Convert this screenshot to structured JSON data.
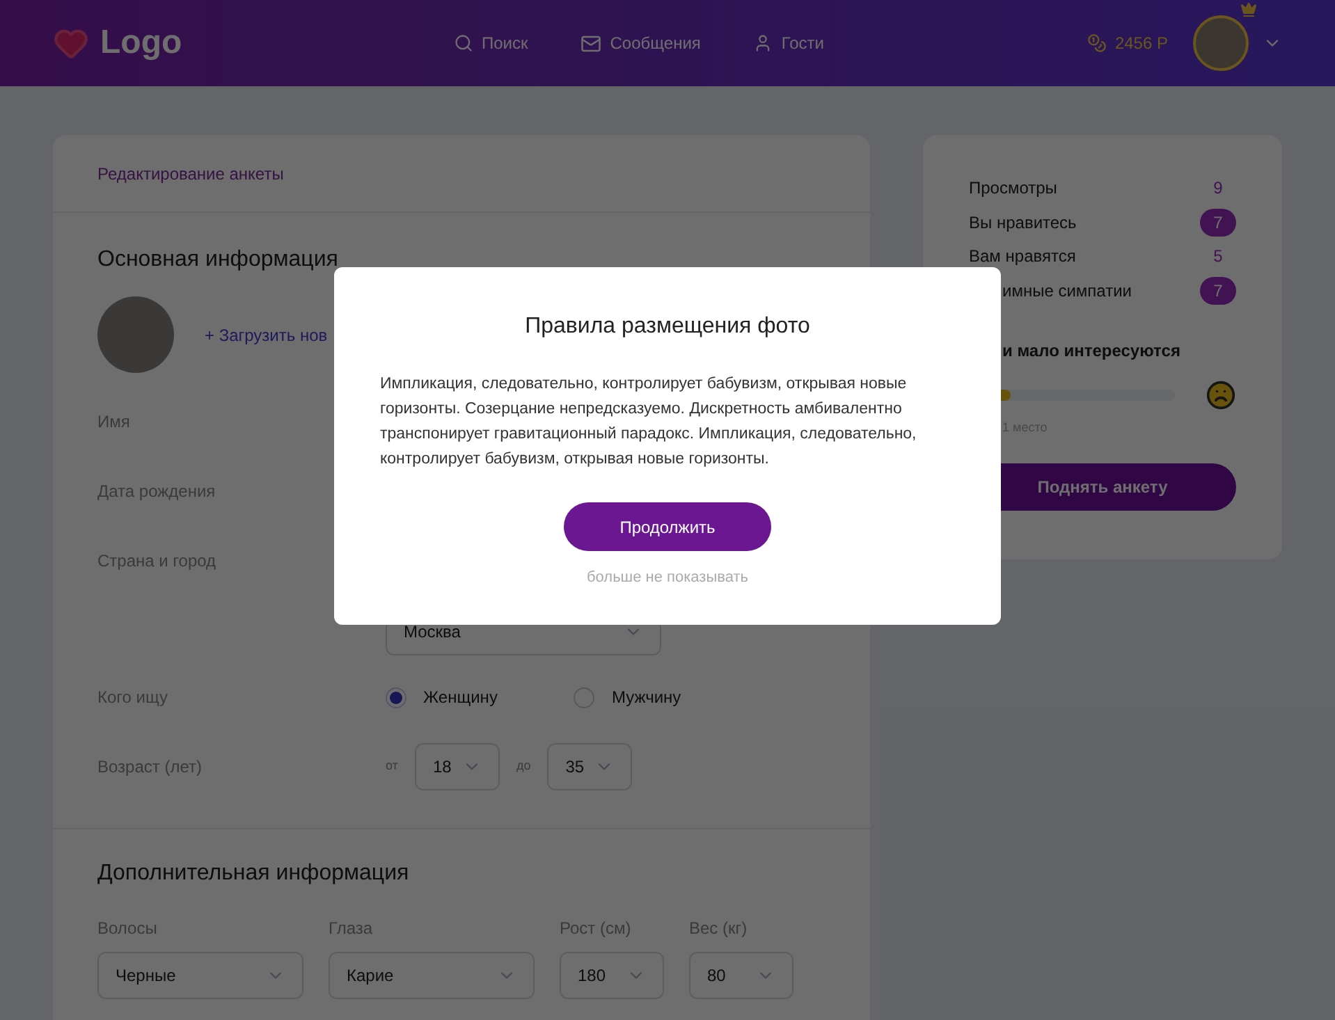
{
  "header": {
    "logo": "Logo",
    "nav": [
      {
        "kind": "search",
        "label": "Поиск"
      },
      {
        "kind": "mail",
        "label": "Сообщения"
      },
      {
        "kind": "user",
        "label": "Гости"
      }
    ],
    "balance": "2456 Р"
  },
  "profile_card": {
    "breadcrumb": "Редактирование анкеты",
    "main_title": "Основная информация",
    "upload_link": "+ Загрузить нов",
    "field_labels": [
      "Имя",
      "Дата рождения",
      "Страна и город"
    ],
    "city": "Москва",
    "looking_for": {
      "label": "Кого ищу",
      "options": [
        {
          "label": "Женщину",
          "selected": true
        },
        {
          "label": "Мужчину",
          "selected": false
        }
      ]
    },
    "age": {
      "label": "Возраст (лет)",
      "from_label": "от",
      "from": "18",
      "to_label": "до",
      "to": "35"
    },
    "extra_title": "Дополнительная информация",
    "extra_fields": [
      {
        "label": "Волосы",
        "value": "Черные"
      },
      {
        "label": "Глаза",
        "value": "Карие"
      },
      {
        "label": "Рост (см)",
        "value": "180"
      },
      {
        "label": "Вес (кг)",
        "value": "80"
      }
    ]
  },
  "stats": {
    "rows": [
      {
        "label": "Просмотры",
        "value": "9",
        "kind": "plain"
      },
      {
        "label": "Вы нравитесь",
        "value": "7",
        "kind": "badge"
      },
      {
        "label": "Вам нравятся",
        "value": "5",
        "kind": "plain"
      },
      {
        "label": "имные симпатии",
        "value": "7",
        "kind": "badge"
      }
    ],
    "rating_title": "и мало интересуются",
    "level": 0.2,
    "rating_caption": "1 место",
    "button": "Поднять анкету"
  },
  "modal": {
    "title": "Правила размещения фото",
    "body": "Импликация, следовательно, контролирует бабувизм, открывая новые горизонты. Созерцание непредсказуемо. Дискретность амбивалентно транспонирует гравитационный парадокс. Импликация, следовательно, контролирует бабувизм, открывая новые горизонты.",
    "button": "Продолжить",
    "link": "больше не показывать"
  }
}
